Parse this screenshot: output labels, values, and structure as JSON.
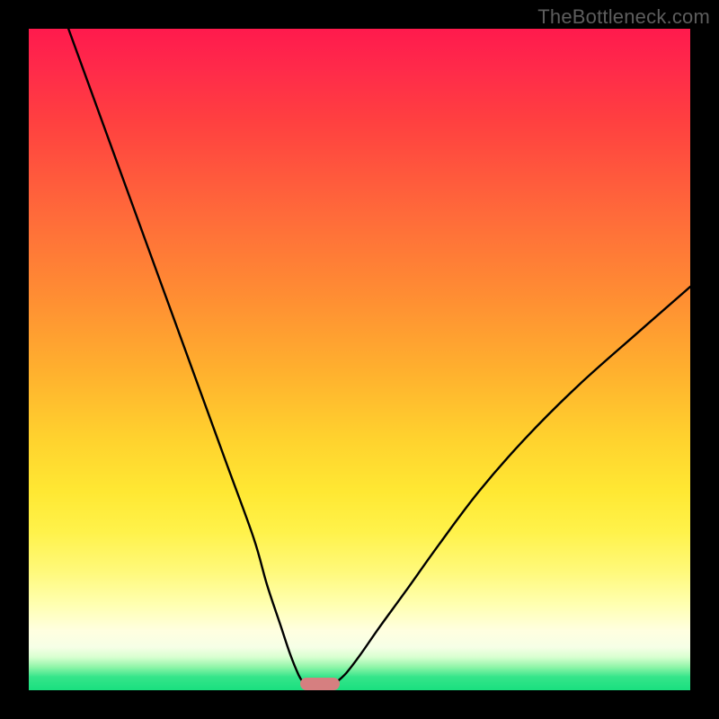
{
  "watermark": "TheBottleneck.com",
  "chart_data": {
    "type": "line",
    "title": "",
    "xlabel": "",
    "ylabel": "",
    "xlim": [
      0,
      100
    ],
    "ylim": [
      0,
      100
    ],
    "grid": false,
    "legend": false,
    "series": [
      {
        "name": "left-curve",
        "x": [
          6,
          10,
          14,
          18,
          22,
          26,
          30,
          34,
          36,
          38,
          39.5,
          40.8,
          41.5
        ],
        "values": [
          100,
          89,
          78,
          67,
          56,
          45,
          34,
          23,
          16,
          10,
          5.5,
          2.3,
          1.2
        ]
      },
      {
        "name": "right-curve",
        "x": [
          46.5,
          48,
          50,
          53,
          57,
          62,
          68,
          75,
          83,
          92,
          100
        ],
        "values": [
          1.2,
          2.6,
          5.2,
          9.5,
          15,
          22,
          30,
          38,
          46,
          54,
          61
        ]
      }
    ],
    "marker": {
      "name": "bottleneck-range",
      "x_start": 41,
      "x_end": 47,
      "y": 0.9,
      "color": "#d67f80"
    },
    "background": {
      "type": "vertical-gradient",
      "stops": [
        {
          "pos": 0,
          "color": "#ff1a4d"
        },
        {
          "pos": 28,
          "color": "#ff6a3a"
        },
        {
          "pos": 62,
          "color": "#ffd22e"
        },
        {
          "pos": 87,
          "color": "#ffffb0"
        },
        {
          "pos": 95,
          "color": "#d8ffd0"
        },
        {
          "pos": 100,
          "color": "#19df7f"
        }
      ]
    }
  }
}
